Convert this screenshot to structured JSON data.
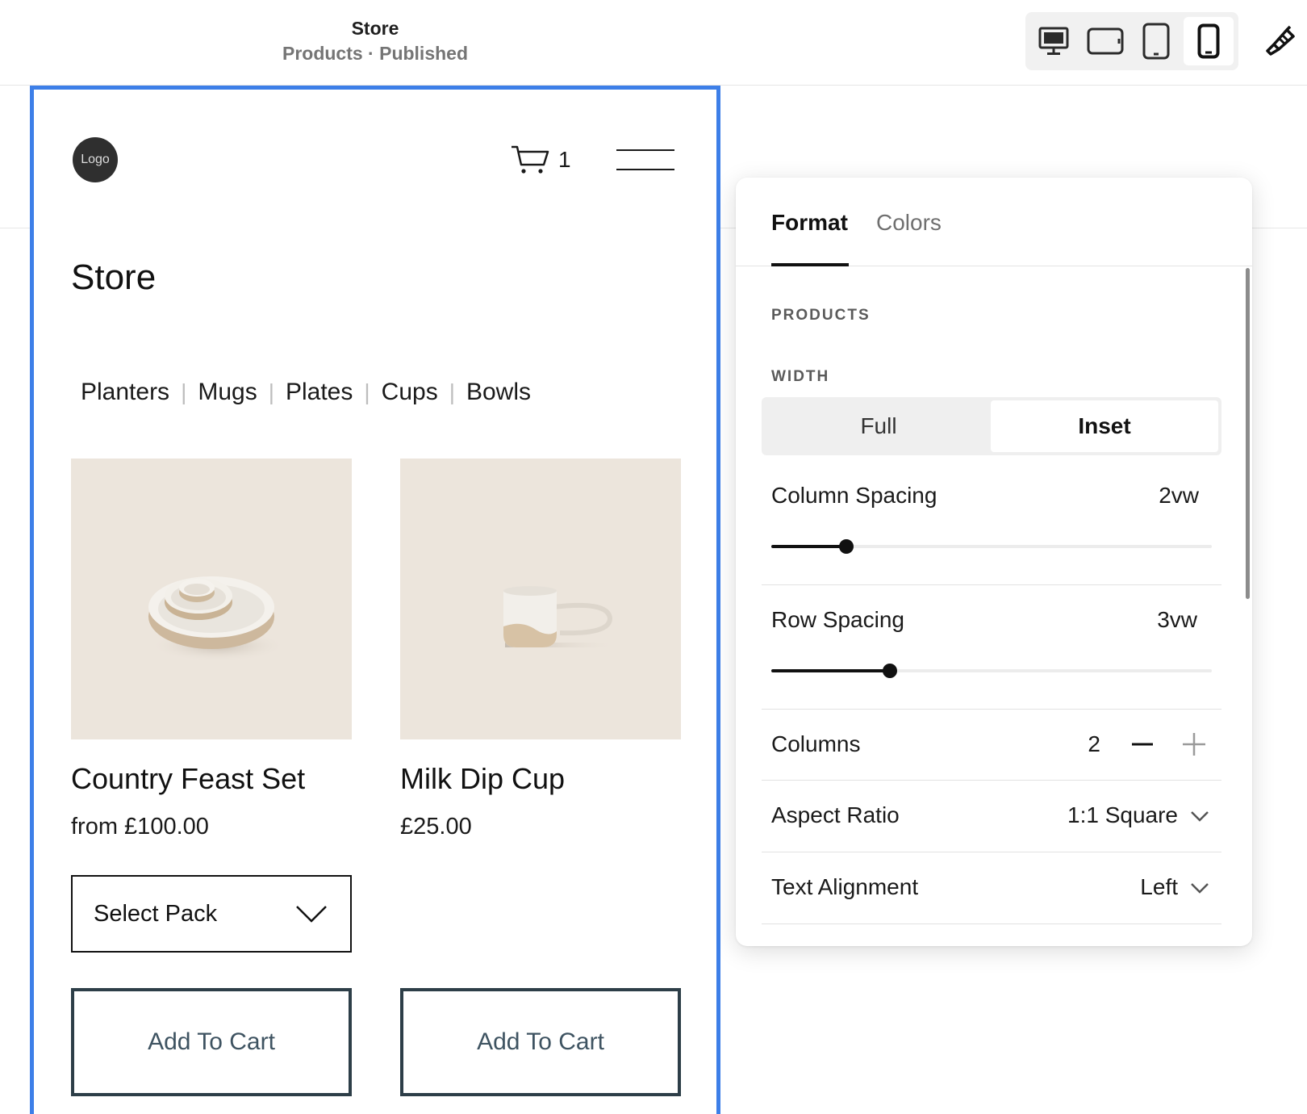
{
  "header": {
    "page_title": "Store",
    "page_subtitle": "Products · Published"
  },
  "devices": [
    {
      "name": "desktop",
      "active": false
    },
    {
      "name": "tablet-landscape",
      "active": false
    },
    {
      "name": "tablet-portrait",
      "active": false
    },
    {
      "name": "mobile",
      "active": true
    }
  ],
  "site": {
    "logo_text": "Logo",
    "cart_count": "1",
    "store_title": "Store",
    "categories": [
      "Planters",
      "Mugs",
      "Plates",
      "Cups",
      "Bowls"
    ],
    "products": [
      {
        "name": "Country Feast Set",
        "price": "from £100.00",
        "select_label": "Select Pack",
        "button": "Add To Cart"
      },
      {
        "name": "Milk Dip Cup",
        "price": "£25.00",
        "button": "Add To Cart"
      }
    ]
  },
  "panel": {
    "tabs": [
      "Format",
      "Colors"
    ],
    "active_tab": "Format",
    "section": "PRODUCTS",
    "width_label": "WIDTH",
    "width_options": [
      "Full",
      "Inset"
    ],
    "width_selected": "Inset",
    "column_spacing": {
      "label": "Column Spacing",
      "value": "2vw",
      "fraction": 0.17
    },
    "row_spacing": {
      "label": "Row Spacing",
      "value": "3vw",
      "fraction": 0.27
    },
    "columns": {
      "label": "Columns",
      "value": "2"
    },
    "aspect_ratio": {
      "label": "Aspect Ratio",
      "value": "1:1 Square"
    },
    "text_alignment": {
      "label": "Text Alignment",
      "value": "Left"
    }
  },
  "colors": {
    "selection_outline": "#3d7fe8",
    "product_bg": "#ece5dc",
    "button_border": "#2d3e48"
  }
}
